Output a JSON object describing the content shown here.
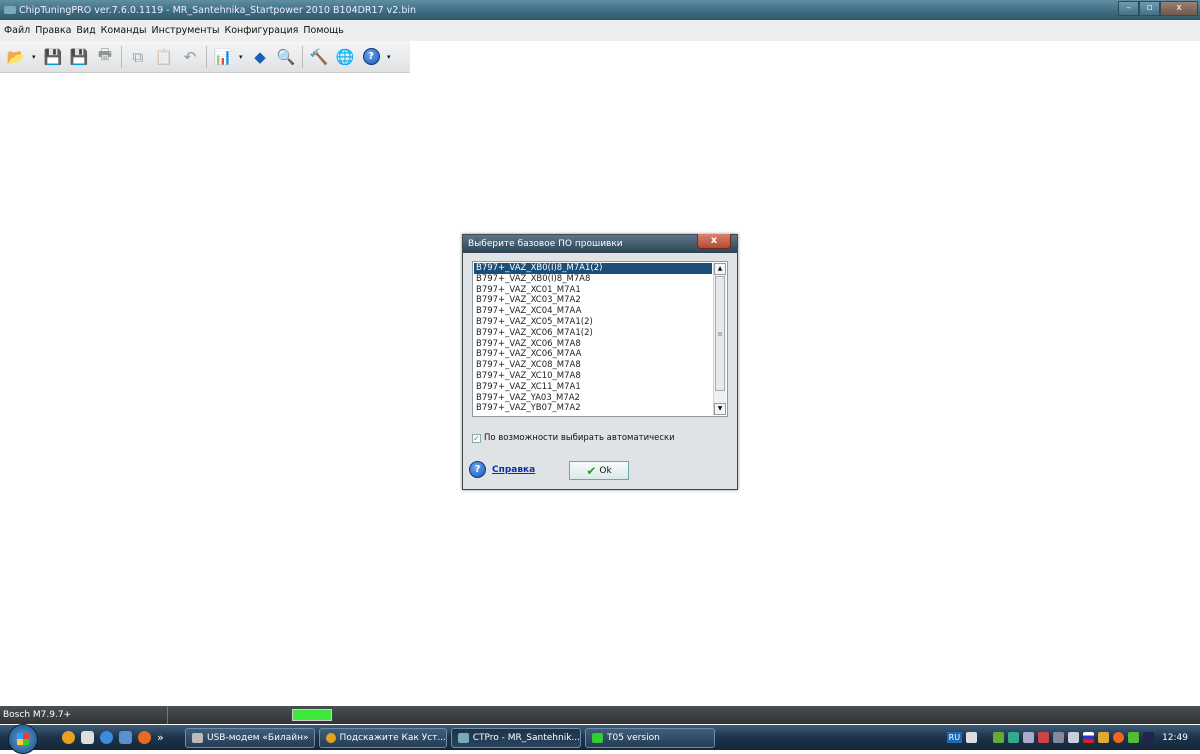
{
  "window": {
    "title": "ChipTuningPRO ver.7.6.0.1119 - MR_Santehnika_Startpower 2010 B104DR17 v2.bin",
    "minimize": "–",
    "maximize": "▫",
    "close": "x"
  },
  "menu": [
    "Файл",
    "Правка",
    "Вид",
    "Команды",
    "Инструменты",
    "Конфигурация",
    "Помощь"
  ],
  "toolbar": [
    "open-icon",
    "save-icon",
    "save-as-icon",
    "print-icon",
    "copy-icon",
    "paste-icon",
    "undo-icon",
    "chart-icon",
    "info-icon",
    "search-icon",
    "tools-icon",
    "web-icon",
    "help-icon"
  ],
  "dialog": {
    "title": "Выберите базовое ПО прошивки",
    "close": "x",
    "items": [
      "B797+_VAZ_XB0(I)8_M7A1(2)",
      "B797+_VAZ_XB0(I)8_M7A8",
      "B797+_VAZ_XC01_M7A1",
      "B797+_VAZ_XC03_M7A2",
      "B797+_VAZ_XC04_M7AA",
      "B797+_VAZ_XC05_M7A1(2)",
      "B797+_VAZ_XC06_M7A1(2)",
      "B797+_VAZ_XC06_M7A8",
      "B797+_VAZ_XC06_M7AA",
      "B797+_VAZ_XC08_M7A8",
      "B797+_VAZ_XC10_M7A8",
      "B797+_VAZ_XC11_M7A1",
      "B797+_VAZ_YA03_M7A2",
      "B797+_VAZ_YB07_M7A2"
    ],
    "selected_index": 0,
    "auto_checkbox": {
      "label": "По возможности выбирать автоматически",
      "checked": true
    },
    "help_link": "Справка",
    "ok": "Ok"
  },
  "statusbar": {
    "ecu": "Bosch M7.9.7+",
    "indicator_color": "#3ee83a"
  },
  "taskbar": {
    "tasks": [
      "USB-модем «Билайн»",
      "Подскажите Как Уст...",
      "CTPro - MR_Santehnik...",
      "T05 version"
    ],
    "lang": "RU",
    "clock": "12:49"
  }
}
